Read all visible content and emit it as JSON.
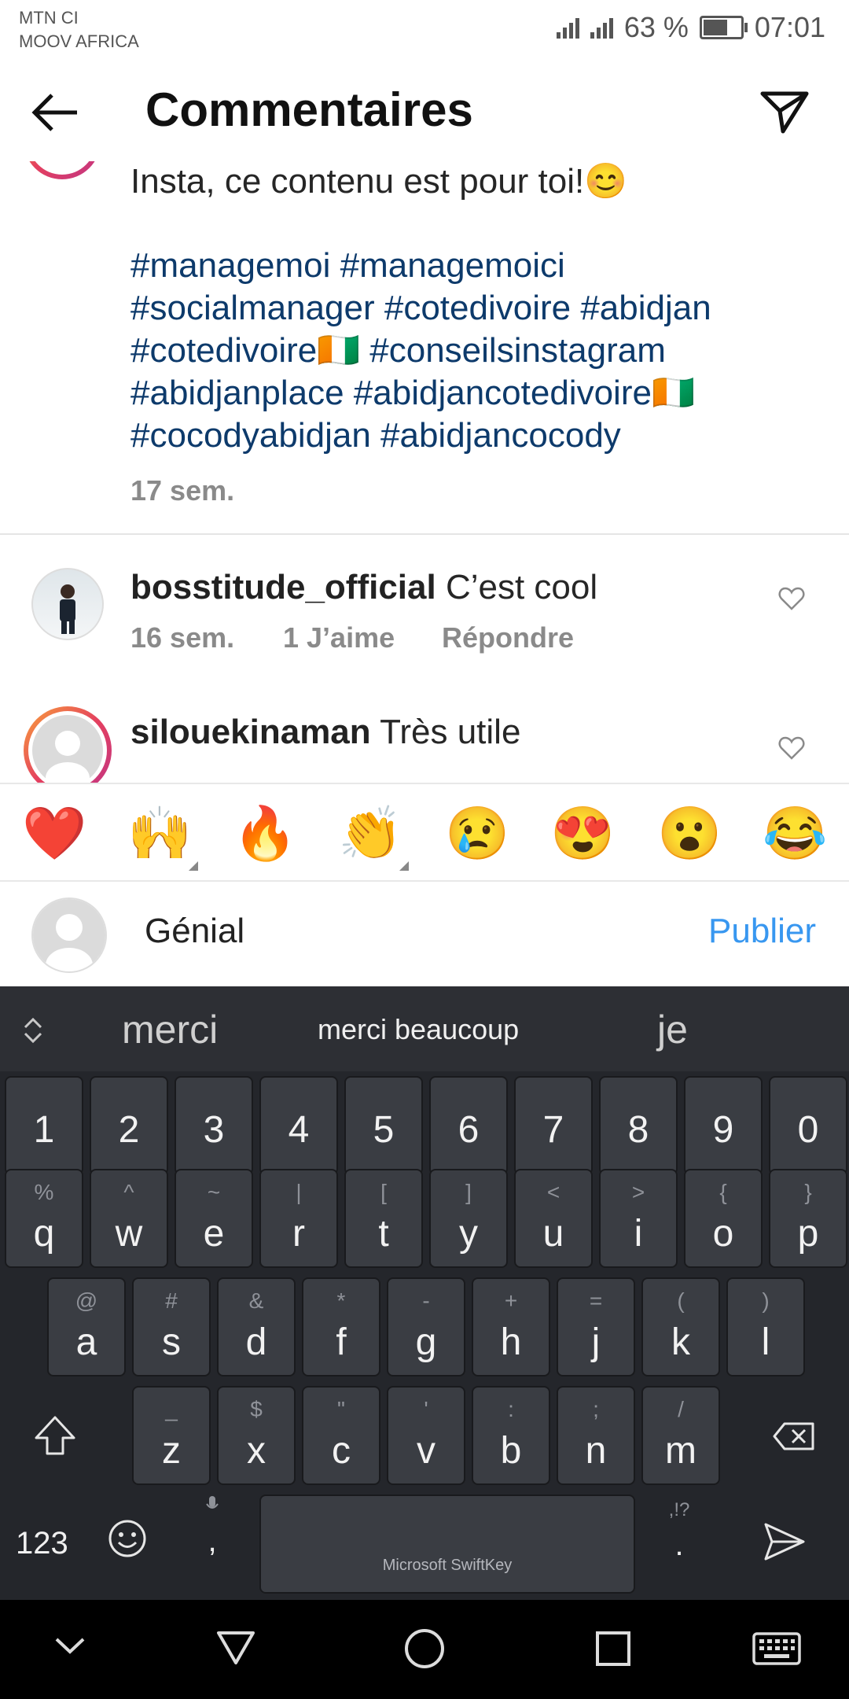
{
  "status_bar": {
    "carrier_1": "MTN CI",
    "carrier_2": "MOOV AFRICA",
    "battery_percent": "63 %",
    "time": "07:01"
  },
  "header": {
    "title": "Commentaires",
    "back_icon": "arrow-left-icon",
    "share_icon": "send-icon"
  },
  "caption": {
    "text": "Insta, ce contenu est pour toi!😊",
    "hashtag_lines": [
      "#managemoi #managemoici",
      "#socialmanager #cotedivoire #abidjan",
      "#cotedivoire🇨🇮 #conseilsinstagram",
      "#abidjanplace #abidjancotedivoire🇨🇮",
      "#cocodyabidjan #abidjancocody"
    ],
    "time": "17 sem."
  },
  "comments": [
    {
      "username": "bosstitude_official",
      "text": "C’est cool",
      "time": "16 sem.",
      "likes": "1 J’aime",
      "reply": "Répondre"
    },
    {
      "username": "silouekinaman",
      "text": "Très utile"
    }
  ],
  "emoji_bar": [
    "❤️",
    "🙌",
    "🔥",
    "👏",
    "😢",
    "😍",
    "😮",
    "😂"
  ],
  "composer": {
    "value": "Génial",
    "post_label": "Publier"
  },
  "keyboard": {
    "suggestions": [
      "merci",
      "merci beaucoup",
      "je"
    ],
    "number_row": [
      "1",
      "2",
      "3",
      "4",
      "5",
      "6",
      "7",
      "8",
      "9",
      "0"
    ],
    "row1": [
      {
        "pri": "q",
        "sec": "%"
      },
      {
        "pri": "w",
        "sec": "^"
      },
      {
        "pri": "e",
        "sec": "~"
      },
      {
        "pri": "r",
        "sec": "|"
      },
      {
        "pri": "t",
        "sec": "["
      },
      {
        "pri": "y",
        "sec": "]"
      },
      {
        "pri": "u",
        "sec": "<"
      },
      {
        "pri": "i",
        "sec": ">"
      },
      {
        "pri": "o",
        "sec": "{"
      },
      {
        "pri": "p",
        "sec": "}"
      }
    ],
    "row2": [
      {
        "pri": "a",
        "sec": "@"
      },
      {
        "pri": "s",
        "sec": "#"
      },
      {
        "pri": "d",
        "sec": "&"
      },
      {
        "pri": "f",
        "sec": "*"
      },
      {
        "pri": "g",
        "sec": "-"
      },
      {
        "pri": "h",
        "sec": "+"
      },
      {
        "pri": "j",
        "sec": "="
      },
      {
        "pri": "k",
        "sec": "("
      },
      {
        "pri": "l",
        "sec": ")"
      }
    ],
    "row3": [
      {
        "pri": "z",
        "sec": "_"
      },
      {
        "pri": "x",
        "sec": "$"
      },
      {
        "pri": "c",
        "sec": "\""
      },
      {
        "pri": "v",
        "sec": "'"
      },
      {
        "pri": "b",
        "sec": ":"
      },
      {
        "pri": "n",
        "sec": ";"
      },
      {
        "pri": "m",
        "sec": "/"
      }
    ],
    "num_toggle": "123",
    "comma": ",",
    "space_label": "Microsoft SwiftKey",
    "period": ".",
    "period_alt": ",!?"
  }
}
